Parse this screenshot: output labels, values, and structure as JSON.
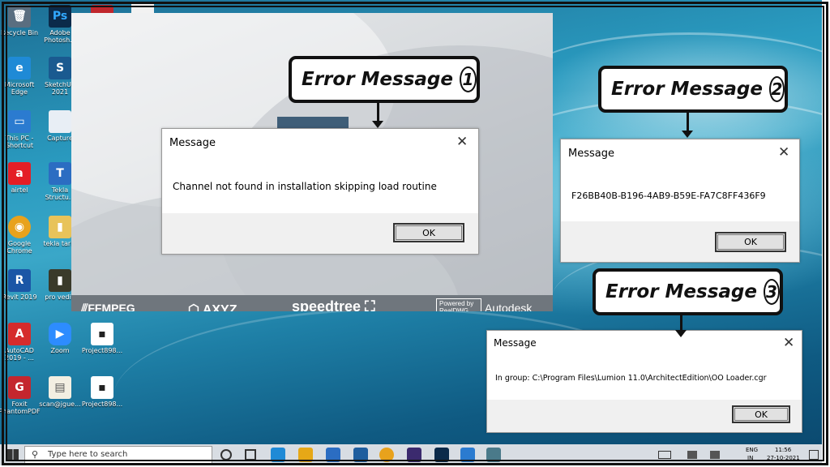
{
  "desktop_icons": [
    {
      "label": "Recycle Bin",
      "color": "#5a6e80",
      "glyph": "🗑"
    },
    {
      "label": "Adobe Photosh...",
      "color": "#0b2a4a",
      "glyph": "Ps"
    },
    {
      "label": "Microsoft Edge",
      "color": "#1f8ad6",
      "glyph": "e"
    },
    {
      "label": "SketchUp 2021",
      "color": "#1a5a90",
      "glyph": "S"
    },
    {
      "label": "This PC - Shortcut",
      "color": "#2b7bd0",
      "glyph": "▭"
    },
    {
      "label": "Capture",
      "color": "#e8eef5",
      "glyph": ""
    },
    {
      "label": "airtel",
      "color": "#e41e26",
      "glyph": "a"
    },
    {
      "label": "Tekla Structu...",
      "color": "#2b6dc2",
      "glyph": "T"
    },
    {
      "label": "Google Chrome",
      "color": "#e8a21c",
      "glyph": "◉"
    },
    {
      "label": "tekla tarin",
      "color": "#e8c35a",
      "glyph": "▮"
    },
    {
      "label": "Revit 2019",
      "color": "#1b56a6",
      "glyph": "R"
    },
    {
      "label": "pro vedio",
      "color": "#3a3a2a",
      "glyph": "▮"
    },
    {
      "label": "AutoCAD 2019 - ...",
      "color": "#d52b2b",
      "glyph": "A"
    },
    {
      "label": "Zoom",
      "color": "#2d8cff",
      "glyph": "▶"
    },
    {
      "label": "Project898...",
      "color": "#ffffff",
      "glyph": "▪"
    },
    {
      "label": "Foxit PhantomPDF",
      "color": "#c4262e",
      "glyph": "G"
    },
    {
      "label": "scan@jgue...",
      "color": "#f3efe2",
      "glyph": "▤"
    },
    {
      "label": "Project898...",
      "color": "#ffffff",
      "glyph": "▪"
    }
  ],
  "installer": {
    "logos": [
      "FFMPEG",
      "AXYZ",
      "speedtree",
      "Powered by RealDWG",
      "Autodesk"
    ]
  },
  "dialogs": [
    {
      "title": "Message",
      "body": "Channel not found in installation skipping load routine",
      "ok": "OK",
      "close": "✕"
    },
    {
      "title": "Message",
      "body": "F26BB40B-B196-4AB9-B59E-FA7C8FF436F9",
      "ok": "OK",
      "close": "✕"
    },
    {
      "title": "Message",
      "body": "In group: C:\\Program Files\\Lumion 11.0\\ArchitectEdition\\OO Loader.cgr",
      "ok": "OK",
      "close": "✕"
    }
  ],
  "callouts": [
    {
      "text": "Error Message",
      "number": "1"
    },
    {
      "text": "Error Message",
      "number": "2"
    },
    {
      "text": "Error Message",
      "number": "3"
    }
  ],
  "taskbar": {
    "search_placeholder": "Type here to search",
    "lang": "ENG",
    "lang_region": "IN",
    "time": "11:56",
    "date": "27-10-2021",
    "app_colors": [
      "#1f8ad6",
      "#e6a817",
      "#2b6dc2",
      "#e8a21c",
      "#3b2a6e",
      "#0b2a4a",
      "#2b7bd0",
      "#4a7a8a"
    ]
  }
}
